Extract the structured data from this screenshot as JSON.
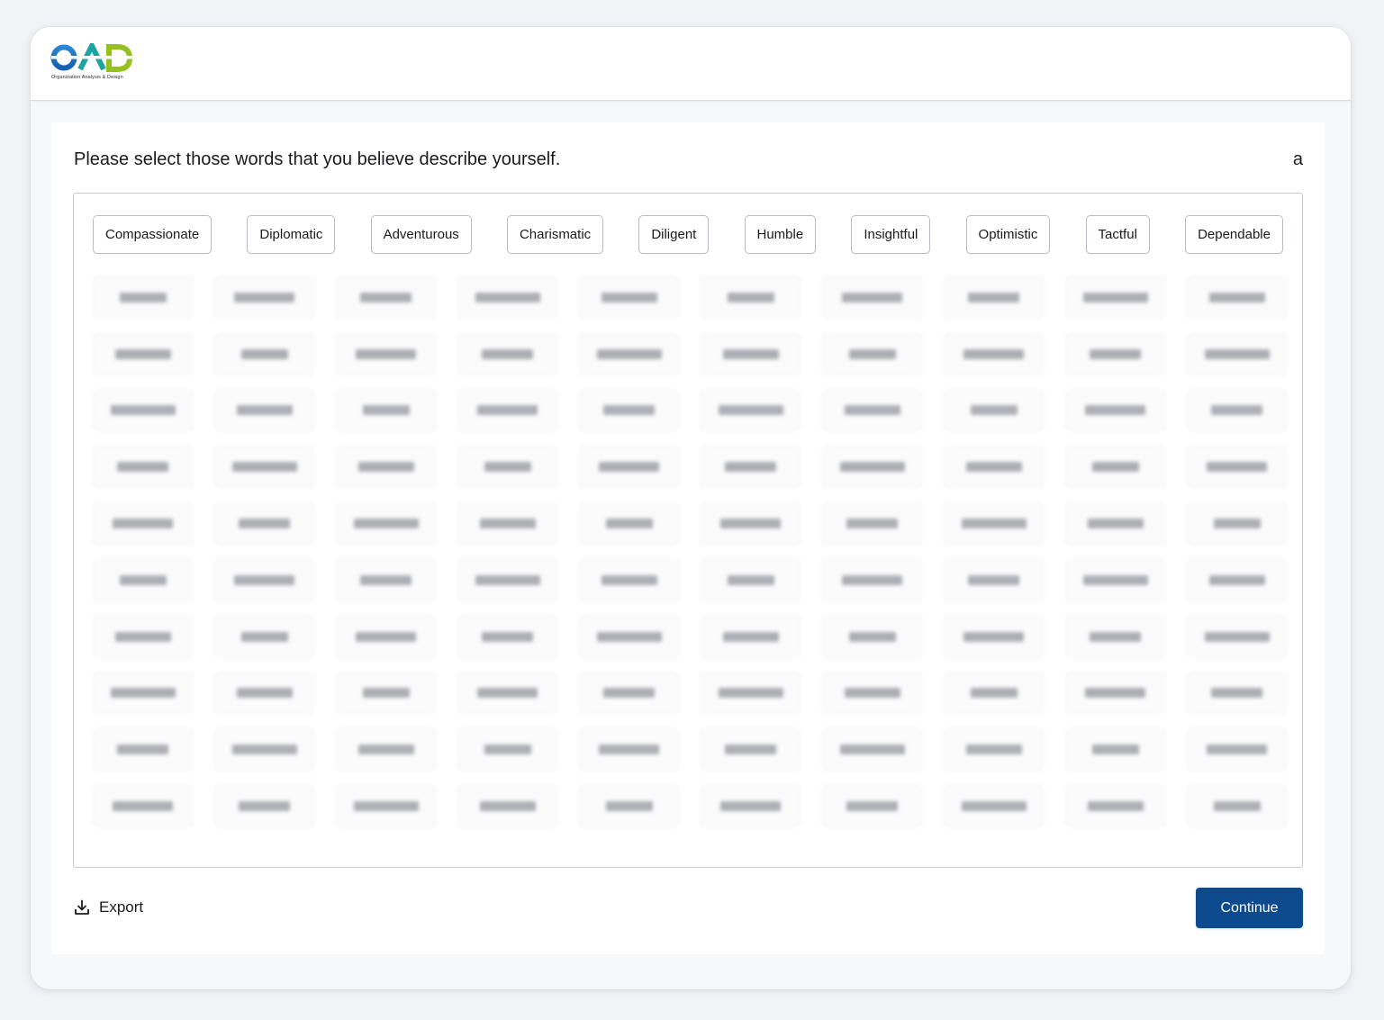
{
  "brand": {
    "logo_text": "OAD",
    "logo_subtitle": "Organization Analysis & Design",
    "colors": {
      "o_blue": "#1c78c8",
      "a_teal": "#1fa3a1",
      "d_green": "#95c11f"
    }
  },
  "main": {
    "instruction": "Please select those words that you believe describe yourself.",
    "corner_letter": "a",
    "words": [
      "Compassionate",
      "Diplomatic",
      "Adventurous",
      "Charismatic",
      "Diligent",
      "Humble",
      "Insightful",
      "Optimistic",
      "Tactful",
      "Dependable"
    ],
    "hidden_rows": 10
  },
  "footer": {
    "export_label": "Export",
    "export_icon": "download-icon",
    "continue_label": "Continue",
    "accent_color": "#0e4a8e"
  }
}
